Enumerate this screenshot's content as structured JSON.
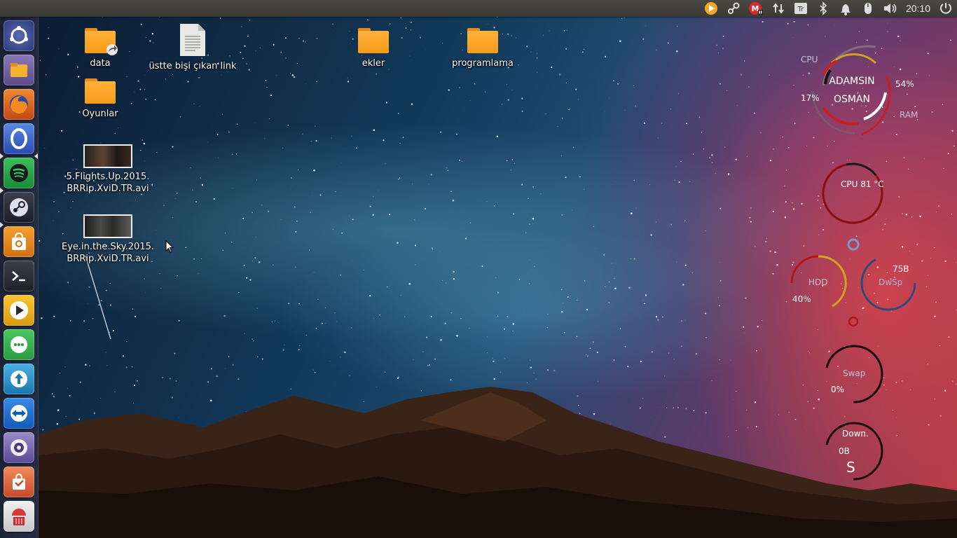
{
  "panel": {
    "clock": "20:10",
    "keyboard_layout": "Tr",
    "tray_icons": [
      "vlc-icon",
      "steam-icon",
      "mega-icon",
      "network-transfer-icon",
      "keyboard-layout-icon",
      "bluetooth-icon",
      "notification-bell-icon",
      "mouse-icon",
      "volume-icon",
      "power-icon"
    ]
  },
  "launcher": {
    "items": [
      {
        "name": "dash-home",
        "color": "#3a4a8a"
      },
      {
        "name": "files",
        "color": "#6a5a9a"
      },
      {
        "name": "firefox",
        "color": "#d35a1a"
      },
      {
        "name": "opera",
        "color": "#3a5ab0"
      },
      {
        "name": "spotify",
        "color": "#2aa84a"
      },
      {
        "name": "steam",
        "color": "#2a2e38"
      },
      {
        "name": "ubuntu-software",
        "color": "#e88a20"
      },
      {
        "name": "terminal",
        "color": "#2e3440"
      },
      {
        "name": "media-player",
        "color": "#e8b020"
      },
      {
        "name": "messaging",
        "color": "#3aa84a"
      },
      {
        "name": "update-manager",
        "color": "#2a8ac0"
      },
      {
        "name": "teamviewer",
        "color": "#1a6ac8"
      },
      {
        "name": "screenshot",
        "color": "#6a5ab0"
      },
      {
        "name": "app-store",
        "color": "#e05a3a"
      },
      {
        "name": "trash",
        "color": "#b03a3a"
      }
    ]
  },
  "desktop": {
    "icons": [
      {
        "label": "data"
      },
      {
        "label": "üstte bişi çıkan link"
      },
      {
        "label": "ekler"
      },
      {
        "label": "programlama"
      },
      {
        "label": "Oyunlar"
      },
      {
        "line1": "5.Flights.Up.2015.",
        "line2": "BRRip.XviD.TR.avi"
      },
      {
        "line1": "Eye.in.the.Sky.2015.",
        "line2": "BRRip.XviD.TR.avi"
      }
    ]
  },
  "conky": {
    "cpu_label": "CPU",
    "ram_label": "RAM",
    "name_line1": "ADAMSIN",
    "name_line2": "OSMAN",
    "cpu_percent": "17%",
    "ram_percent": "54%",
    "cpu_temp": "CPU 81 °C",
    "hdd_label": "HDD",
    "hdd_percent": "40%",
    "dwsp_label": "DwSp",
    "dwsp_value": "75B",
    "swap_label": "Swap",
    "swap_percent": "0%",
    "down_label": "Down.",
    "down_value": "0B",
    "down_unit": "S"
  },
  "colors": {
    "panel": "#3b3a36",
    "folder": "#f59a1a",
    "conky_red": "#c81e1e",
    "conky_gold": "#d4a020",
    "conky_white": "#ffffff",
    "conky_blue": "#3a5a8a"
  }
}
